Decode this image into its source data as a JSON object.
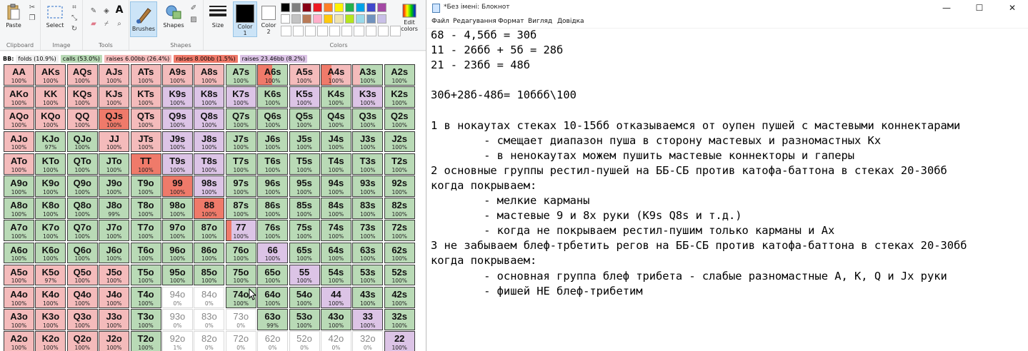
{
  "paint": {
    "ribbon": {
      "clipboard": {
        "paste": "Paste",
        "label": "Clipboard"
      },
      "image": {
        "select": "Select",
        "label": "Image"
      },
      "tools": {
        "label": "Tools"
      },
      "brushes": {
        "label": "Brushes"
      },
      "shapes": {
        "button": "Shapes",
        "label": "Shapes"
      },
      "size": {
        "label": "Size"
      },
      "color1": {
        "line1": "Color",
        "line2": "1"
      },
      "color2": {
        "line1": "Color",
        "line2": "2"
      },
      "colors": {
        "label": "Colors"
      },
      "edit_colors": {
        "line1": "Edit",
        "line2": "colors"
      },
      "palette_row1": [
        "#000000",
        "#7f7f7f",
        "#880015",
        "#ed1c24",
        "#ff7f27",
        "#fff200",
        "#22b14c",
        "#00a2e8",
        "#3f48cc",
        "#a349a4"
      ],
      "palette_row2": [
        "#ffffff",
        "#c3c3c3",
        "#b97a57",
        "#ffaec9",
        "#ffc90e",
        "#efe4b0",
        "#b5e61d",
        "#99d9ea",
        "#7092be",
        "#c8bfe7"
      ]
    },
    "legend": {
      "title": "BB:",
      "items": [
        {
          "text": "folds (10.9%)",
          "color": "#f0f0f0"
        },
        {
          "text": "calls (53.0%)",
          "color": "#b9dab6"
        },
        {
          "text": "raises 6.00bb (26.4%)",
          "color": "#f4bbbb"
        },
        {
          "text": "raises 8.00bb (1.5%)",
          "color": "#ef7a6a"
        },
        {
          "text": "raises 23.46bb (8.2%)",
          "color": "#dcc4e6"
        }
      ]
    },
    "colors": {
      "green": "#b9dab6",
      "pink": "#f4bbbb",
      "red": "#ef7a6a",
      "purple": "#dcc4e6",
      "white": "#ffffff"
    },
    "grid": [
      [
        {
          "h": "AA",
          "p": "100%",
          "c": "pink"
        },
        {
          "h": "AKs",
          "p": "100%",
          "c": "pink"
        },
        {
          "h": "AQs",
          "p": "100%",
          "c": "pink"
        },
        {
          "h": "AJs",
          "p": "100%",
          "c": "pink"
        },
        {
          "h": "ATs",
          "p": "100%",
          "c": "pink"
        },
        {
          "h": "A9s",
          "p": "100%",
          "c": "pink"
        },
        {
          "h": "A8s",
          "p": "100%",
          "c": "pink"
        },
        {
          "h": "A7s",
          "p": "100%",
          "c": "green"
        },
        {
          "h": "A6s",
          "p": "100%",
          "c": "green",
          "s": "red",
          "sw": 20
        },
        {
          "h": "A5s",
          "p": "100%",
          "c": "pink"
        },
        {
          "h": "A4s",
          "p": "100%",
          "c": "pink",
          "s": "red",
          "sw": 14
        },
        {
          "h": "A3s",
          "p": "100%",
          "c": "green",
          "s": "pink",
          "sw": 10
        },
        {
          "h": "A2s",
          "p": "100%",
          "c": "green"
        }
      ],
      [
        {
          "h": "AKo",
          "p": "100%",
          "c": "pink"
        },
        {
          "h": "KK",
          "p": "100%",
          "c": "pink"
        },
        {
          "h": "KQs",
          "p": "100%",
          "c": "pink"
        },
        {
          "h": "KJs",
          "p": "100%",
          "c": "pink"
        },
        {
          "h": "KTs",
          "p": "100%",
          "c": "pink"
        },
        {
          "h": "K9s",
          "p": "100%",
          "c": "purple"
        },
        {
          "h": "K8s",
          "p": "100%",
          "c": "purple"
        },
        {
          "h": "K7s",
          "p": "100%",
          "c": "purple"
        },
        {
          "h": "K6s",
          "p": "100%",
          "c": "green"
        },
        {
          "h": "K5s",
          "p": "100%",
          "c": "purple"
        },
        {
          "h": "K4s",
          "p": "100%",
          "c": "green"
        },
        {
          "h": "K3s",
          "p": "100%",
          "c": "purple"
        },
        {
          "h": "K2s",
          "p": "100%",
          "c": "green"
        }
      ],
      [
        {
          "h": "AQo",
          "p": "100%",
          "c": "pink"
        },
        {
          "h": "KQo",
          "p": "100%",
          "c": "pink"
        },
        {
          "h": "QQ",
          "p": "100%",
          "c": "pink"
        },
        {
          "h": "QJs",
          "p": "100%",
          "c": "red"
        },
        {
          "h": "QTs",
          "p": "100%",
          "c": "pink"
        },
        {
          "h": "Q9s",
          "p": "100%",
          "c": "purple"
        },
        {
          "h": "Q8s",
          "p": "100%",
          "c": "purple"
        },
        {
          "h": "Q7s",
          "p": "100%",
          "c": "green"
        },
        {
          "h": "Q6s",
          "p": "100%",
          "c": "green"
        },
        {
          "h": "Q5s",
          "p": "100%",
          "c": "green"
        },
        {
          "h": "Q4s",
          "p": "100%",
          "c": "green"
        },
        {
          "h": "Q3s",
          "p": "100%",
          "c": "green"
        },
        {
          "h": "Q2s",
          "p": "100%",
          "c": "green"
        }
      ],
      [
        {
          "h": "AJo",
          "p": "100%",
          "c": "pink"
        },
        {
          "h": "KJo",
          "p": "97%",
          "c": "green"
        },
        {
          "h": "QJo",
          "p": "100%",
          "c": "green"
        },
        {
          "h": "JJ",
          "p": "100%",
          "c": "pink"
        },
        {
          "h": "JTs",
          "p": "100%",
          "c": "pink"
        },
        {
          "h": "J9s",
          "p": "100%",
          "c": "purple"
        },
        {
          "h": "J8s",
          "p": "100%",
          "c": "purple"
        },
        {
          "h": "J7s",
          "p": "100%",
          "c": "green"
        },
        {
          "h": "J6s",
          "p": "100%",
          "c": "green"
        },
        {
          "h": "J5s",
          "p": "100%",
          "c": "green"
        },
        {
          "h": "J4s",
          "p": "100%",
          "c": "green"
        },
        {
          "h": "J3s",
          "p": "100%",
          "c": "green"
        },
        {
          "h": "J2s",
          "p": "100%",
          "c": "green"
        }
      ],
      [
        {
          "h": "ATo",
          "p": "100%",
          "c": "pink"
        },
        {
          "h": "KTo",
          "p": "100%",
          "c": "green"
        },
        {
          "h": "QTo",
          "p": "100%",
          "c": "green"
        },
        {
          "h": "JTo",
          "p": "100%",
          "c": "green"
        },
        {
          "h": "TT",
          "p": "100%",
          "c": "red"
        },
        {
          "h": "T9s",
          "p": "100%",
          "c": "purple"
        },
        {
          "h": "T8s",
          "p": "100%",
          "c": "purple"
        },
        {
          "h": "T7s",
          "p": "100%",
          "c": "green"
        },
        {
          "h": "T6s",
          "p": "100%",
          "c": "green"
        },
        {
          "h": "T5s",
          "p": "100%",
          "c": "green"
        },
        {
          "h": "T4s",
          "p": "100%",
          "c": "green"
        },
        {
          "h": "T3s",
          "p": "100%",
          "c": "green"
        },
        {
          "h": "T2s",
          "p": "100%",
          "c": "green"
        }
      ],
      [
        {
          "h": "A9o",
          "p": "100%",
          "c": "green"
        },
        {
          "h": "K9o",
          "p": "100%",
          "c": "green"
        },
        {
          "h": "Q9o",
          "p": "100%",
          "c": "green"
        },
        {
          "h": "J9o",
          "p": "100%",
          "c": "green"
        },
        {
          "h": "T9o",
          "p": "100%",
          "c": "green"
        },
        {
          "h": "99",
          "p": "100%",
          "c": "red"
        },
        {
          "h": "98s",
          "p": "100%",
          "c": "purple"
        },
        {
          "h": "97s",
          "p": "100%",
          "c": "green"
        },
        {
          "h": "96s",
          "p": "100%",
          "c": "green"
        },
        {
          "h": "95s",
          "p": "100%",
          "c": "green"
        },
        {
          "h": "94s",
          "p": "100%",
          "c": "green"
        },
        {
          "h": "93s",
          "p": "100%",
          "c": "green"
        },
        {
          "h": "92s",
          "p": "100%",
          "c": "green"
        }
      ],
      [
        {
          "h": "A8o",
          "p": "100%",
          "c": "green"
        },
        {
          "h": "K8o",
          "p": "100%",
          "c": "green"
        },
        {
          "h": "Q8o",
          "p": "100%",
          "c": "green"
        },
        {
          "h": "J8o",
          "p": "99%",
          "c": "green"
        },
        {
          "h": "T8o",
          "p": "100%",
          "c": "green"
        },
        {
          "h": "98o",
          "p": "100%",
          "c": "green"
        },
        {
          "h": "88",
          "p": "100%",
          "c": "red"
        },
        {
          "h": "87s",
          "p": "100%",
          "c": "green"
        },
        {
          "h": "86s",
          "p": "100%",
          "c": "green"
        },
        {
          "h": "85s",
          "p": "100%",
          "c": "green"
        },
        {
          "h": "84s",
          "p": "100%",
          "c": "green"
        },
        {
          "h": "83s",
          "p": "100%",
          "c": "green"
        },
        {
          "h": "82s",
          "p": "100%",
          "c": "green"
        }
      ],
      [
        {
          "h": "A7o",
          "p": "100%",
          "c": "green"
        },
        {
          "h": "K7o",
          "p": "100%",
          "c": "green"
        },
        {
          "h": "Q7o",
          "p": "100%",
          "c": "green"
        },
        {
          "h": "J7o",
          "p": "100%",
          "c": "green"
        },
        {
          "h": "T7o",
          "p": "100%",
          "c": "green"
        },
        {
          "h": "97o",
          "p": "100%",
          "c": "green"
        },
        {
          "h": "87o",
          "p": "100%",
          "c": "green"
        },
        {
          "h": "77",
          "p": "100%",
          "c": "purple",
          "s": "red",
          "sw": 7
        },
        {
          "h": "76s",
          "p": "100%",
          "c": "green"
        },
        {
          "h": "75s",
          "p": "100%",
          "c": "green"
        },
        {
          "h": "74s",
          "p": "100%",
          "c": "green"
        },
        {
          "h": "73s",
          "p": "100%",
          "c": "green"
        },
        {
          "h": "72s",
          "p": "100%",
          "c": "green"
        }
      ],
      [
        {
          "h": "A6o",
          "p": "100%",
          "c": "green"
        },
        {
          "h": "K6o",
          "p": "100%",
          "c": "green"
        },
        {
          "h": "Q6o",
          "p": "100%",
          "c": "green"
        },
        {
          "h": "J6o",
          "p": "100%",
          "c": "green"
        },
        {
          "h": "T6o",
          "p": "100%",
          "c": "green"
        },
        {
          "h": "96o",
          "p": "100%",
          "c": "green"
        },
        {
          "h": "86o",
          "p": "100%",
          "c": "green"
        },
        {
          "h": "76o",
          "p": "100%",
          "c": "green"
        },
        {
          "h": "66",
          "p": "100%",
          "c": "purple"
        },
        {
          "h": "65s",
          "p": "100%",
          "c": "green"
        },
        {
          "h": "64s",
          "p": "100%",
          "c": "green"
        },
        {
          "h": "63s",
          "p": "100%",
          "c": "green"
        },
        {
          "h": "62s",
          "p": "100%",
          "c": "green"
        }
      ],
      [
        {
          "h": "A5o",
          "p": "100%",
          "c": "pink"
        },
        {
          "h": "K5o",
          "p": "97%",
          "c": "pink"
        },
        {
          "h": "Q5o",
          "p": "100%",
          "c": "pink"
        },
        {
          "h": "J5o",
          "p": "100%",
          "c": "pink"
        },
        {
          "h": "T5o",
          "p": "100%",
          "c": "green"
        },
        {
          "h": "95o",
          "p": "100%",
          "c": "green"
        },
        {
          "h": "85o",
          "p": "100%",
          "c": "green"
        },
        {
          "h": "75o",
          "p": "100%",
          "c": "green"
        },
        {
          "h": "65o",
          "p": "100%",
          "c": "green"
        },
        {
          "h": "55",
          "p": "100%",
          "c": "purple"
        },
        {
          "h": "54s",
          "p": "100%",
          "c": "green"
        },
        {
          "h": "53s",
          "p": "100%",
          "c": "green"
        },
        {
          "h": "52s",
          "p": "100%",
          "c": "green"
        }
      ],
      [
        {
          "h": "A4o",
          "p": "100%",
          "c": "pink"
        },
        {
          "h": "K4o",
          "p": "100%",
          "c": "pink"
        },
        {
          "h": "Q4o",
          "p": "100%",
          "c": "pink"
        },
        {
          "h": "J4o",
          "p": "100%",
          "c": "pink"
        },
        {
          "h": "T4o",
          "p": "100%",
          "c": "green"
        },
        {
          "h": "94o",
          "p": "0%",
          "c": "white"
        },
        {
          "h": "84o",
          "p": "0%",
          "c": "white"
        },
        {
          "h": "74o",
          "p": "100%",
          "c": "green"
        },
        {
          "h": "64o",
          "p": "100%",
          "c": "green"
        },
        {
          "h": "54o",
          "p": "100%",
          "c": "green"
        },
        {
          "h": "44",
          "p": "100%",
          "c": "purple"
        },
        {
          "h": "43s",
          "p": "100%",
          "c": "green"
        },
        {
          "h": "42s",
          "p": "100%",
          "c": "green"
        }
      ],
      [
        {
          "h": "A3o",
          "p": "100%",
          "c": "pink"
        },
        {
          "h": "K3o",
          "p": "100%",
          "c": "pink"
        },
        {
          "h": "Q3o",
          "p": "100%",
          "c": "pink"
        },
        {
          "h": "J3o",
          "p": "100%",
          "c": "pink"
        },
        {
          "h": "T3o",
          "p": "100%",
          "c": "green"
        },
        {
          "h": "93o",
          "p": "0%",
          "c": "white"
        },
        {
          "h": "83o",
          "p": "0%",
          "c": "white"
        },
        {
          "h": "73o",
          "p": "0%",
          "c": "white"
        },
        {
          "h": "63o",
          "p": "99%",
          "c": "green"
        },
        {
          "h": "53o",
          "p": "100%",
          "c": "green"
        },
        {
          "h": "43o",
          "p": "100%",
          "c": "green"
        },
        {
          "h": "33",
          "p": "100%",
          "c": "purple"
        },
        {
          "h": "32s",
          "p": "100%",
          "c": "green"
        }
      ],
      [
        {
          "h": "A2o",
          "p": "100%",
          "c": "pink"
        },
        {
          "h": "K2o",
          "p": "100%",
          "c": "pink"
        },
        {
          "h": "Q2o",
          "p": "100%",
          "c": "pink"
        },
        {
          "h": "J2o",
          "p": "100%",
          "c": "pink"
        },
        {
          "h": "T2o",
          "p": "100%",
          "c": "green"
        },
        {
          "h": "92o",
          "p": "1%",
          "c": "white"
        },
        {
          "h": "82o",
          "p": "0%",
          "c": "white"
        },
        {
          "h": "72o",
          "p": "0%",
          "c": "white"
        },
        {
          "h": "62o",
          "p": "0%",
          "c": "white"
        },
        {
          "h": "52o",
          "p": "0%",
          "c": "white"
        },
        {
          "h": "42o",
          "p": "0%",
          "c": "white"
        },
        {
          "h": "32o",
          "p": "0%",
          "c": "white"
        },
        {
          "h": "22",
          "p": "100%",
          "c": "purple"
        }
      ]
    ]
  },
  "notepad": {
    "title": "*Без імені: Блокнот",
    "window_buttons": {
      "minimize": "—",
      "maximize": "☐",
      "close": "✕"
    },
    "menu": [
      "Файл",
      "Редагування",
      "Формат",
      "Вигляд",
      "Довідка"
    ],
    "lines": [
      "68 - 4,5бб = 30б",
      "11 - 26бб + 5б = 28б",
      "21 - 23бб = 48б",
      "",
      "30б+28б-48б= 10ббб\\100",
      "",
      "1 в нокаутах стеках 10-15бб отказываемся от оупен пушей с мастевыми коннектарами",
      "        - смещает диапазон пуша в сторону мастевых и разномастных Кх",
      "        - в ненокаутах можем пушить мастевые коннекторы и гаперы",
      "2 основные группы рестил-пушей на ББ-СБ против катофа-баттона в стеках 20-30бб",
      "когда покрываем:",
      "        - мелкие карманы",
      "        - мастевые 9 и 8х руки (K9s Q8s и т.д.)",
      "        - когда не покрываем рестил-пушим только карманы и Ах",
      "3 не забываем блеф-трбетить регов на ББ-СБ против катофа-баттона в стеках 20-30бб",
      "когда покрываем:",
      "        - основная группа блеф трибета - слабые разномастные A, K, Q и Jx руки",
      "        - фишей НЕ блеф-трибетим"
    ]
  }
}
